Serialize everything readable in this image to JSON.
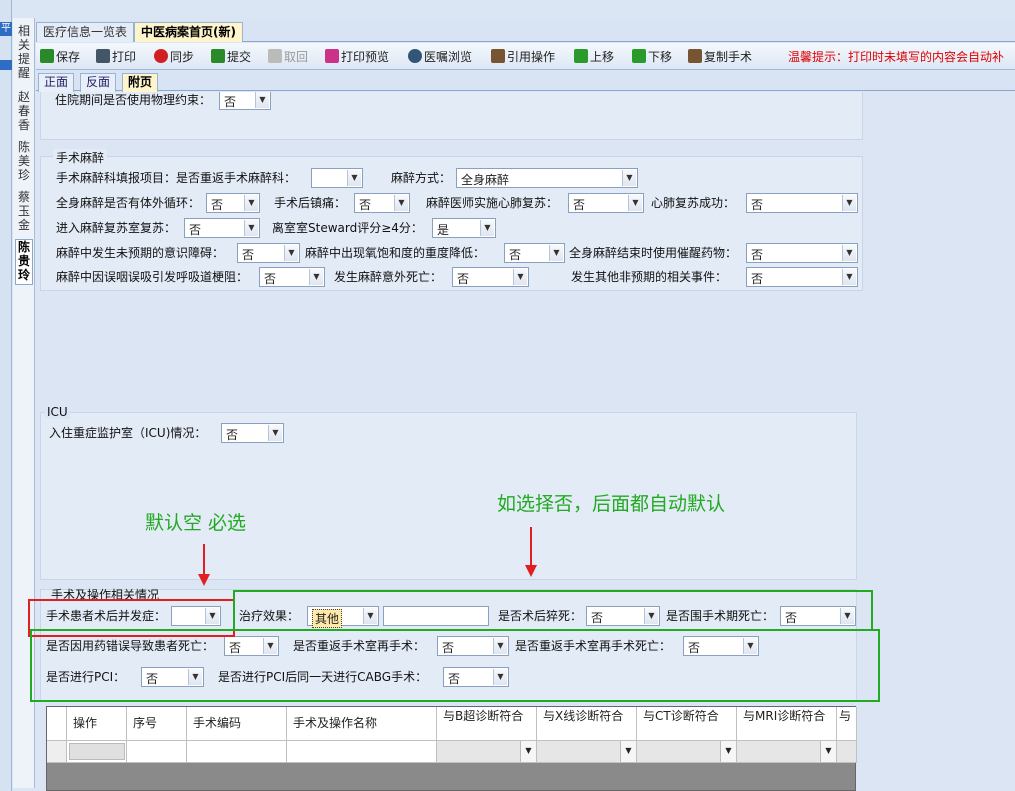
{
  "left_blue": "平",
  "side_tabs": [
    "相关提醒",
    "赵春香",
    "陈美珍",
    "蔡玉金",
    "陈贵玲"
  ],
  "top_tabs": [
    "医疗信息一览表",
    "中医病案首页(新)"
  ],
  "toolbar": [
    {
      "label": "保存",
      "icon": "save-icon",
      "color": "#2a8a2a"
    },
    {
      "label": "打印",
      "icon": "printer-icon",
      "color": "#445566"
    },
    {
      "label": "同步",
      "icon": "sync-icon",
      "color": "#d02020"
    },
    {
      "label": "提交",
      "icon": "submit-icon",
      "color": "#2a8a2a"
    },
    {
      "label": "取回",
      "icon": "retrieve-icon",
      "color": "#999999"
    },
    {
      "label": "打印预览",
      "icon": "print-preview-icon",
      "color": "#cc3388"
    },
    {
      "label": "医嘱浏览",
      "icon": "magnifier-icon",
      "color": "#335577"
    },
    {
      "label": "引用操作",
      "icon": "quote-icon",
      "color": "#775533"
    },
    {
      "label": "上移",
      "icon": "arrow-up-icon",
      "color": "#2a9a2a"
    },
    {
      "label": "下移",
      "icon": "arrow-down-icon",
      "color": "#2a9a2a"
    },
    {
      "label": "复制手术",
      "icon": "copy-icon",
      "color": "#775533"
    }
  ],
  "tip": "温馨提示：打印时未填写的内容会自动补",
  "sub_tabs": [
    "正面",
    "反面",
    "附页"
  ],
  "physical_restraint": {
    "label": "住院期间是否使用物理约束：",
    "value": "否"
  },
  "anesthesia": {
    "title": "手术麻醉",
    "report_label": "手术麻醉科填报项目：是否重返手术麻醉科：",
    "report_value": "",
    "method_label": "麻醉方式：",
    "method_value": "全身麻醉",
    "ecmo_label": "全身麻醉是否有体外循环：",
    "ecmo_value": "否",
    "shiver_label": "手术后镇痛：",
    "shiver_value": "否",
    "cpr_label": "麻醉医师实施心肺复苏：",
    "cpr_value": "否",
    "cpr_success_label": "心肺复苏成功：",
    "cpr_success_value": "否",
    "pacu_label": "进入麻醉复苏室复苏：",
    "pacu_value": "否",
    "steward_label": "离室室Steward评分≥4分：",
    "steward_value": "是",
    "unconscious_label": "麻醉中发生未预期的意识障碍：",
    "unconscious_value": "否",
    "spo2_label": "麻醉中出现氧饱和度的重度降低：",
    "spo2_value": "否",
    "reversal_label": "全身麻醉结束时使用催醒药物：",
    "reversal_value": "否",
    "aspiration_label": "麻醉中因误咽误吸引发呼吸道梗阻：",
    "aspiration_value": "否",
    "death_label": "发生麻醉意外死亡：",
    "death_value": "否",
    "other_label": "发生其他非预期的相关事件：",
    "other_value": "否"
  },
  "icu": {
    "title": "ICU",
    "label": "入住重症监护室（ICU)情况：",
    "value": "否"
  },
  "annotations": {
    "default_empty": "默认空 必选",
    "if_no": "如选择否，后面都自动默认"
  },
  "surgery": {
    "title": "手术及操作相关情况",
    "complication_label": "手术患者术后并发症：",
    "complication_value": "",
    "effect_label": "治疗效果：",
    "effect_value": "其他",
    "sudden_death_label": "是否术后猝死：",
    "sudden_death_value": "否",
    "periop_death_label": "是否围手术期死亡：",
    "periop_death_value": "否",
    "med_error_label": "是否因用药错误导致患者死亡：",
    "med_error_value": "否",
    "return_or_label": "是否重返手术室再手术：",
    "return_or_value": "否",
    "return_or_death_label": "是否重返手术室再手术死亡：",
    "return_or_death_value": "否",
    "pci_label": "是否进行PCI：",
    "pci_value": "否",
    "cabg_label": "是否进行PCI后同一天进行CABG手术：",
    "cabg_value": "否"
  },
  "table": {
    "headers": [
      "操作",
      "序号",
      "手术编码",
      "手术及操作名称",
      "与B超诊断符合",
      "与X线诊断符合",
      "与CT诊断符合",
      "与MRI诊断符合",
      "与"
    ]
  }
}
